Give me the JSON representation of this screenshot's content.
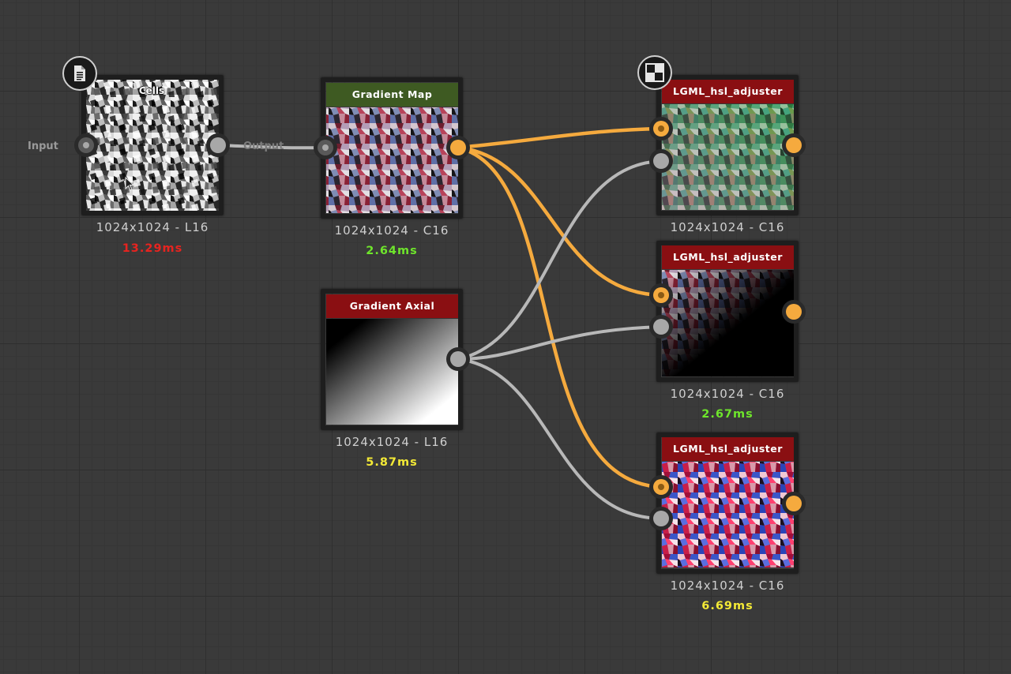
{
  "graph": {
    "nodes": [
      {
        "id": "cells",
        "title": "Cells",
        "resolution": "1024x1024 - L16",
        "timing": "13.29ms",
        "timing_color": "#e8231f",
        "input_label": "Input",
        "output_label": "Output",
        "badge_icon": "document-icon"
      },
      {
        "id": "gradient-map",
        "title": "Gradient Map",
        "resolution": "1024x1024 - C16",
        "timing": "2.64ms",
        "timing_color": "#6ee52b"
      },
      {
        "id": "gradient-axial",
        "title": "Gradient Axial",
        "resolution": "1024x1024 - L16",
        "timing": "5.87ms",
        "timing_color": "#f3e936"
      },
      {
        "id": "hsl-adjuster-1",
        "title": "LGML_hsl_adjuster",
        "resolution": "1024x1024 - C16",
        "timing": "",
        "badge_icon": "checker-icon"
      },
      {
        "id": "hsl-adjuster-2",
        "title": "LGML_hsl_adjuster",
        "resolution": "1024x1024 - C16",
        "timing": "2.67ms",
        "timing_color": "#6ee52b"
      },
      {
        "id": "hsl-adjuster-3",
        "title": "LGML_hsl_adjuster",
        "resolution": "1024x1024 - C16",
        "timing": "6.69ms",
        "timing_color": "#f3e936"
      }
    ]
  },
  "colors": {
    "wire_color_output": "#f5aa3e",
    "wire_grayscale": "#b8b8b8",
    "title_green": "#3e5a22",
    "title_red": "#8a0f12",
    "canvas_bg": "#3a3a3a"
  }
}
